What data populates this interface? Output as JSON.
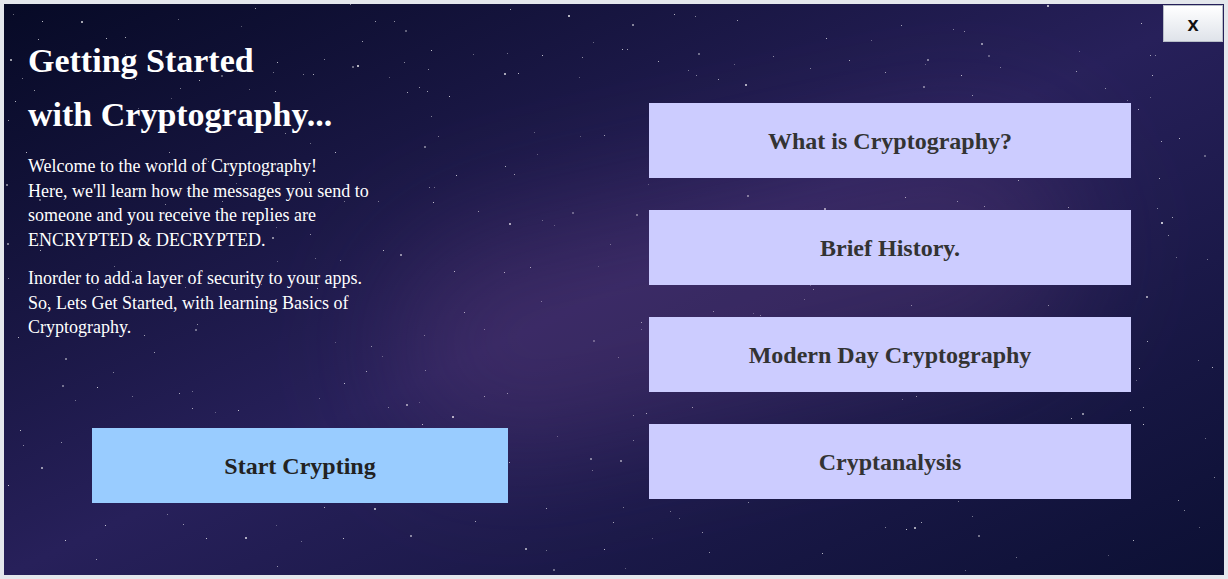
{
  "window": {
    "close": "x"
  },
  "title": [
    "Getting Started",
    "with Cryptography..."
  ],
  "intro": [
    [
      "Welcome to the world of Cryptography!",
      "Here, we'll learn how the messages you send to",
      "someone and you receive the replies are",
      "ENCRYPTED & DECRYPTED."
    ],
    [
      "Inorder to add a layer of security to your apps.",
      "So, Lets Get Started, with learning Basics of",
      "Cryptography."
    ]
  ],
  "start_button": "Start Crypting",
  "menu": [
    "What is Cryptography?",
    "Brief History.",
    "Modern Day Cryptography",
    "Cryptanalysis"
  ]
}
